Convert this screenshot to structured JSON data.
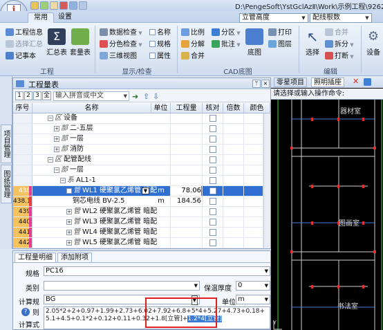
{
  "window": {
    "title_path": "D:\\PengeSoft\\YstGclAzⅡ\\Work\\示例工程\\9262",
    "logo_text": "i",
    "logo_sub": "AZ"
  },
  "ribbon": {
    "tabs": [
      "常用",
      "设置"
    ],
    "combo1": "立管高度",
    "combo2": "配线根数",
    "groups": {
      "project": {
        "label": "工程",
        "items": [
          "工程信息",
          "选择汇总",
          "记事本"
        ],
        "big": [
          "汇总表",
          "套量表"
        ]
      },
      "display": {
        "label": "显示/检查",
        "items": [
          "数据检查",
          "分色检查",
          "三维视图"
        ],
        "checks": [
          "名称",
          "规格",
          "属性"
        ]
      },
      "cad": {
        "label": "CAD底图",
        "items": [
          "比例",
          "分解",
          "合并",
          "分区",
          "批注"
        ],
        "big": "底图",
        "side": [
          "打印",
          "图层"
        ]
      },
      "edit": {
        "label": "编辑",
        "big": "选择",
        "items": [
          "合并",
          "拆分",
          "打断"
        ],
        "settings": "设备"
      }
    }
  },
  "side_tabs": [
    "项目管理",
    "图纸管理"
  ],
  "table_panel": {
    "title": "工程量表",
    "levels": [
      "1",
      "2",
      "3",
      "全"
    ],
    "search_placeholder": "输入拼音或中文",
    "columns": [
      "序号",
      "名称",
      "单位",
      "工程量",
      "核对",
      "倍数",
      "颜色"
    ],
    "rows": [
      {
        "seq": "",
        "name": "设备",
        "indent": 2,
        "prefix": "区",
        "unit": "",
        "qty": "",
        "toggle": "−"
      },
      {
        "seq": "",
        "name": "二-五层",
        "indent": 3,
        "prefix": "部",
        "unit": "",
        "qty": "",
        "toggle": "+"
      },
      {
        "seq": "",
        "name": "一层",
        "indent": 3,
        "prefix": "部",
        "unit": "",
        "qty": "",
        "toggle": "+"
      },
      {
        "seq": "",
        "name": "消防",
        "indent": 3,
        "prefix": "部",
        "unit": "",
        "qty": "",
        "toggle": "+"
      },
      {
        "seq": "",
        "name": "配管配线",
        "indent": 2,
        "prefix": "区",
        "unit": "",
        "qty": "",
        "toggle": "−"
      },
      {
        "seq": "",
        "name": "一层",
        "indent": 3,
        "prefix": "部",
        "unit": "",
        "qty": "",
        "toggle": "−"
      },
      {
        "seq": "",
        "name": "AL1-1",
        "indent": 4,
        "prefix": "系",
        "unit": "",
        "qty": "",
        "toggle": "−"
      },
      {
        "seq": "438",
        "name": "WL1 硬聚氯乙烯管 暗配",
        "indent": 5,
        "prefix": "管",
        "unit": "m",
        "qty": "78.06",
        "toggle": "−",
        "selected": true
      },
      {
        "seq": "438.1",
        "name": "铜芯电线 BV-2.5",
        "indent": 6,
        "prefix": "",
        "unit": "m",
        "qty": "184.56",
        "toggle": ""
      },
      {
        "seq": "439",
        "name": "WL2 硬聚氯乙烯管 暗配",
        "indent": 5,
        "prefix": "管",
        "unit": "",
        "qty": "",
        "toggle": "+"
      },
      {
        "seq": "440",
        "name": "WL3 硬聚氯乙烯管 暗配",
        "indent": 5,
        "prefix": "管",
        "unit": "",
        "qty": "",
        "toggle": "+"
      },
      {
        "seq": "441",
        "name": "WL4 硬聚氯乙烯管 暗配",
        "indent": 5,
        "prefix": "管",
        "unit": "",
        "qty": "",
        "toggle": "+"
      },
      {
        "seq": "442",
        "name": "WL5 硬聚氯乙烯管 暗配",
        "indent": 5,
        "prefix": "管",
        "unit": "",
        "qty": "",
        "toggle": "+"
      }
    ]
  },
  "detail": {
    "tabs": [
      "工程量明细",
      "添加附项"
    ],
    "spec_label": "规格",
    "spec_value": "PC16",
    "category_label": "类别",
    "insulation_label": "保温厚度",
    "insulation_value": "0",
    "rule_label": "计算规则",
    "rule_value": "BG",
    "unit_label": "单位",
    "unit_value": "m",
    "formula_label": "计算式",
    "formula_text": "2.05*2+2+0.97+1.99+2.73+6.02+7.92+6.8+5*4+5.27+4.73+0.18+5.1+4.5+0.1*2+0.12+0.11+0.32+1.8[立管]+",
    "formula_selected": "1.2*4[立管]"
  },
  "right_panel": {
    "tabs": [
      "零星项目",
      "照明插座"
    ],
    "cmd_prompt": "请选择或输入操作命令:",
    "cad_labels": [
      "器材室",
      "图画室",
      "书法室"
    ]
  }
}
